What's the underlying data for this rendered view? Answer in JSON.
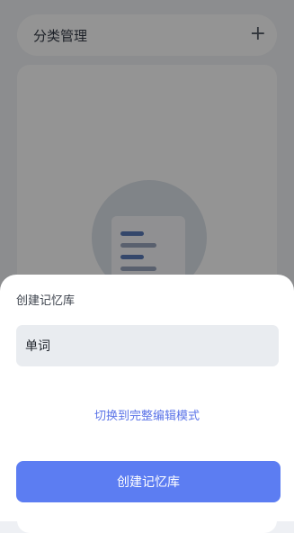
{
  "background": {
    "category_title": "分类管理",
    "add_icon": "plus-icon",
    "add_glyph": "+"
  },
  "sheet": {
    "title": "创建记忆库",
    "input_value": "单词",
    "switch_link": "切换到完整编辑模式",
    "create_button": "创建记忆库"
  },
  "colors": {
    "accent": "#5c7df2",
    "link": "#5b74e8"
  }
}
